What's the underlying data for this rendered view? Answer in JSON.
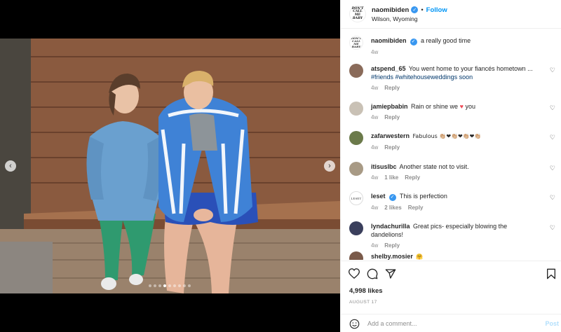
{
  "post": {
    "username": "naomibiden",
    "follow_label": "Follow",
    "location": "Wilson, Wyoming",
    "logo_text": "DON'T CALL ME BABY",
    "caption": "a really good time",
    "caption_age": "4w"
  },
  "media": {
    "prev_arrow": "‹",
    "next_arrow": "›",
    "dot_count": 9,
    "active_dot": 3
  },
  "comments": [
    {
      "user": "atspend_65",
      "text": "You went home to your fiancés hometown ...",
      "tags": "#friends #whitehouseweddings soon",
      "age": "4w",
      "reply": "Reply",
      "avatar_color": "#8a6b5a",
      "verified": false
    },
    {
      "user": "jamiepbabin",
      "text_before": "Rain or shine we",
      "text_after": "you",
      "age": "4w",
      "reply": "Reply",
      "avatar_color": "#c9c1b5",
      "verified": false
    },
    {
      "user": "zafarwestern",
      "text": "Fabulous 👏🏼❤👏🏼❤👏🏼❤👏🏼",
      "age": "4w",
      "reply": "Reply",
      "avatar_color": "#6b7a4a",
      "verified": false
    },
    {
      "user": "itisuslbc",
      "text": "Another state not to visit.",
      "age": "4w",
      "likes": "1 like",
      "reply": "Reply",
      "avatar_color": "#a89a85",
      "verified": false
    },
    {
      "user": "leset",
      "text": "This is perfection",
      "age": "4w",
      "likes": "2 likes",
      "reply": "Reply",
      "avatar_text": "LESET",
      "verified": true
    },
    {
      "user": "lyndachurilla",
      "text": "Great pics- especially blowing the dandelions!",
      "age": "4w",
      "reply": "Reply",
      "avatar_color": "#3a3f5c",
      "verified": false
    },
    {
      "user": "shelby.mosier",
      "text": "🤗",
      "avatar_color": "#7a5a4a",
      "verified": false
    }
  ],
  "stats": {
    "likes": "4,998 likes",
    "date": "AUGUST 17"
  },
  "composer": {
    "placeholder": "Add a comment...",
    "post_label": "Post"
  },
  "colors": {
    "accent": "#0095f6",
    "verified": "#3897f0",
    "muted": "#8e8e8e"
  }
}
